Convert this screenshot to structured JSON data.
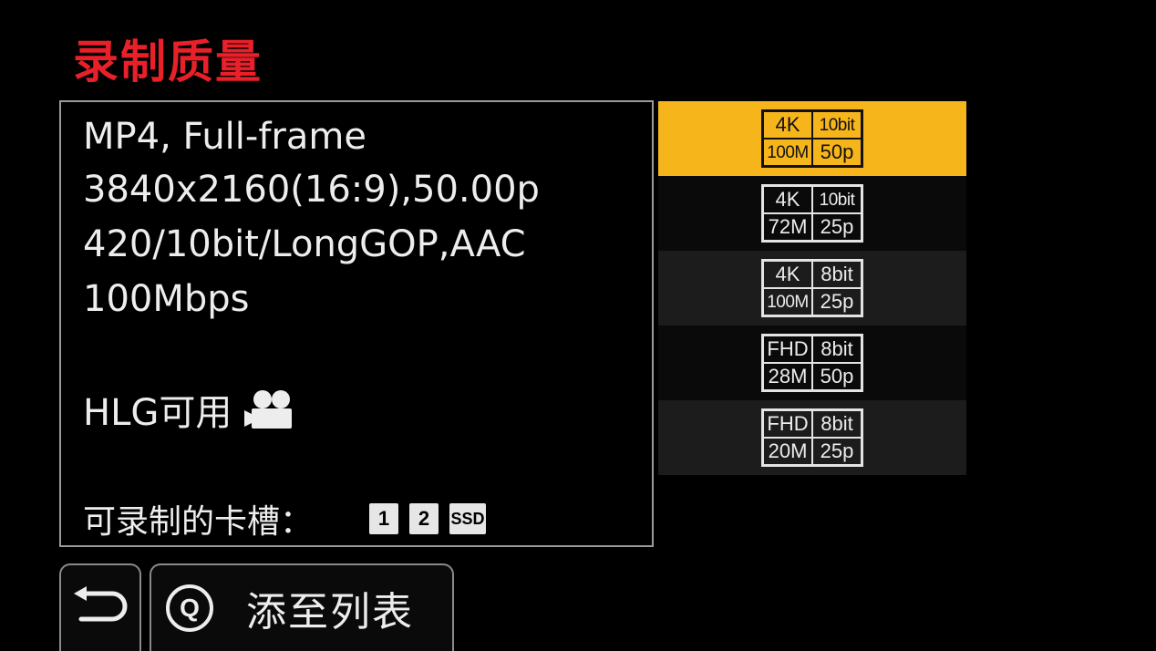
{
  "title": "录制质量",
  "info": {
    "line1": "MP4, Full-frame",
    "line2": "3840x2160(16:9),50.00p",
    "line3": "420/10bit/LongGOP,AAC",
    "line4": "100Mbps",
    "hlg_label": "HLG可用",
    "hlg_icon": "movie-camera-icon",
    "slots_label": "可录制的卡槽：",
    "slots": [
      "1",
      "2",
      "SSD"
    ]
  },
  "quality_list": [
    {
      "res": "4K",
      "bit": "10bit",
      "rate": "100M",
      "fps": "50p",
      "selected": true
    },
    {
      "res": "4K",
      "bit": "10bit",
      "rate": "72M",
      "fps": "25p",
      "selected": false
    },
    {
      "res": "4K",
      "bit": "8bit",
      "rate": "100M",
      "fps": "25p",
      "selected": false
    },
    {
      "res": "FHD",
      "bit": "8bit",
      "rate": "28M",
      "fps": "50p",
      "selected": false
    },
    {
      "res": "FHD",
      "bit": "8bit",
      "rate": "20M",
      "fps": "25p",
      "selected": false
    }
  ],
  "buttons": {
    "back_icon": "return-arrow-icon",
    "q_key": "Q",
    "add_label": "添至列表"
  },
  "colors": {
    "title": "#e8202a",
    "selected": "#f7b51c",
    "background": "#000000"
  }
}
